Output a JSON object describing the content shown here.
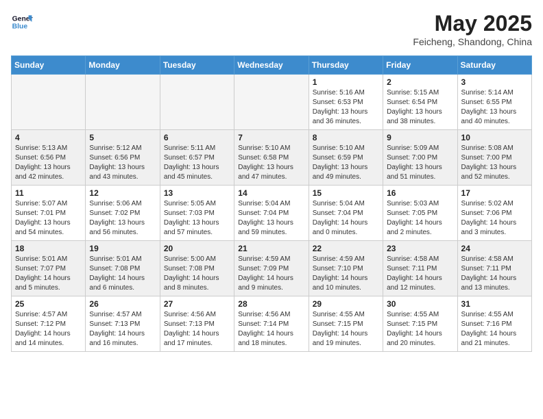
{
  "header": {
    "logo_line1": "General",
    "logo_line2": "Blue",
    "month": "May 2025",
    "location": "Feicheng, Shandong, China"
  },
  "weekdays": [
    "Sunday",
    "Monday",
    "Tuesday",
    "Wednesday",
    "Thursday",
    "Friday",
    "Saturday"
  ],
  "weeks": [
    [
      {
        "day": "",
        "info": ""
      },
      {
        "day": "",
        "info": ""
      },
      {
        "day": "",
        "info": ""
      },
      {
        "day": "",
        "info": ""
      },
      {
        "day": "1",
        "info": "Sunrise: 5:16 AM\nSunset: 6:53 PM\nDaylight: 13 hours\nand 36 minutes."
      },
      {
        "day": "2",
        "info": "Sunrise: 5:15 AM\nSunset: 6:54 PM\nDaylight: 13 hours\nand 38 minutes."
      },
      {
        "day": "3",
        "info": "Sunrise: 5:14 AM\nSunset: 6:55 PM\nDaylight: 13 hours\nand 40 minutes."
      }
    ],
    [
      {
        "day": "4",
        "info": "Sunrise: 5:13 AM\nSunset: 6:56 PM\nDaylight: 13 hours\nand 42 minutes."
      },
      {
        "day": "5",
        "info": "Sunrise: 5:12 AM\nSunset: 6:56 PM\nDaylight: 13 hours\nand 43 minutes."
      },
      {
        "day": "6",
        "info": "Sunrise: 5:11 AM\nSunset: 6:57 PM\nDaylight: 13 hours\nand 45 minutes."
      },
      {
        "day": "7",
        "info": "Sunrise: 5:10 AM\nSunset: 6:58 PM\nDaylight: 13 hours\nand 47 minutes."
      },
      {
        "day": "8",
        "info": "Sunrise: 5:10 AM\nSunset: 6:59 PM\nDaylight: 13 hours\nand 49 minutes."
      },
      {
        "day": "9",
        "info": "Sunrise: 5:09 AM\nSunset: 7:00 PM\nDaylight: 13 hours\nand 51 minutes."
      },
      {
        "day": "10",
        "info": "Sunrise: 5:08 AM\nSunset: 7:00 PM\nDaylight: 13 hours\nand 52 minutes."
      }
    ],
    [
      {
        "day": "11",
        "info": "Sunrise: 5:07 AM\nSunset: 7:01 PM\nDaylight: 13 hours\nand 54 minutes."
      },
      {
        "day": "12",
        "info": "Sunrise: 5:06 AM\nSunset: 7:02 PM\nDaylight: 13 hours\nand 56 minutes."
      },
      {
        "day": "13",
        "info": "Sunrise: 5:05 AM\nSunset: 7:03 PM\nDaylight: 13 hours\nand 57 minutes."
      },
      {
        "day": "14",
        "info": "Sunrise: 5:04 AM\nSunset: 7:04 PM\nDaylight: 13 hours\nand 59 minutes."
      },
      {
        "day": "15",
        "info": "Sunrise: 5:04 AM\nSunset: 7:04 PM\nDaylight: 14 hours\nand 0 minutes."
      },
      {
        "day": "16",
        "info": "Sunrise: 5:03 AM\nSunset: 7:05 PM\nDaylight: 14 hours\nand 2 minutes."
      },
      {
        "day": "17",
        "info": "Sunrise: 5:02 AM\nSunset: 7:06 PM\nDaylight: 14 hours\nand 3 minutes."
      }
    ],
    [
      {
        "day": "18",
        "info": "Sunrise: 5:01 AM\nSunset: 7:07 PM\nDaylight: 14 hours\nand 5 minutes."
      },
      {
        "day": "19",
        "info": "Sunrise: 5:01 AM\nSunset: 7:08 PM\nDaylight: 14 hours\nand 6 minutes."
      },
      {
        "day": "20",
        "info": "Sunrise: 5:00 AM\nSunset: 7:08 PM\nDaylight: 14 hours\nand 8 minutes."
      },
      {
        "day": "21",
        "info": "Sunrise: 4:59 AM\nSunset: 7:09 PM\nDaylight: 14 hours\nand 9 minutes."
      },
      {
        "day": "22",
        "info": "Sunrise: 4:59 AM\nSunset: 7:10 PM\nDaylight: 14 hours\nand 10 minutes."
      },
      {
        "day": "23",
        "info": "Sunrise: 4:58 AM\nSunset: 7:11 PM\nDaylight: 14 hours\nand 12 minutes."
      },
      {
        "day": "24",
        "info": "Sunrise: 4:58 AM\nSunset: 7:11 PM\nDaylight: 14 hours\nand 13 minutes."
      }
    ],
    [
      {
        "day": "25",
        "info": "Sunrise: 4:57 AM\nSunset: 7:12 PM\nDaylight: 14 hours\nand 14 minutes."
      },
      {
        "day": "26",
        "info": "Sunrise: 4:57 AM\nSunset: 7:13 PM\nDaylight: 14 hours\nand 16 minutes."
      },
      {
        "day": "27",
        "info": "Sunrise: 4:56 AM\nSunset: 7:13 PM\nDaylight: 14 hours\nand 17 minutes."
      },
      {
        "day": "28",
        "info": "Sunrise: 4:56 AM\nSunset: 7:14 PM\nDaylight: 14 hours\nand 18 minutes."
      },
      {
        "day": "29",
        "info": "Sunrise: 4:55 AM\nSunset: 7:15 PM\nDaylight: 14 hours\nand 19 minutes."
      },
      {
        "day": "30",
        "info": "Sunrise: 4:55 AM\nSunset: 7:15 PM\nDaylight: 14 hours\nand 20 minutes."
      },
      {
        "day": "31",
        "info": "Sunrise: 4:55 AM\nSunset: 7:16 PM\nDaylight: 14 hours\nand 21 minutes."
      }
    ]
  ]
}
